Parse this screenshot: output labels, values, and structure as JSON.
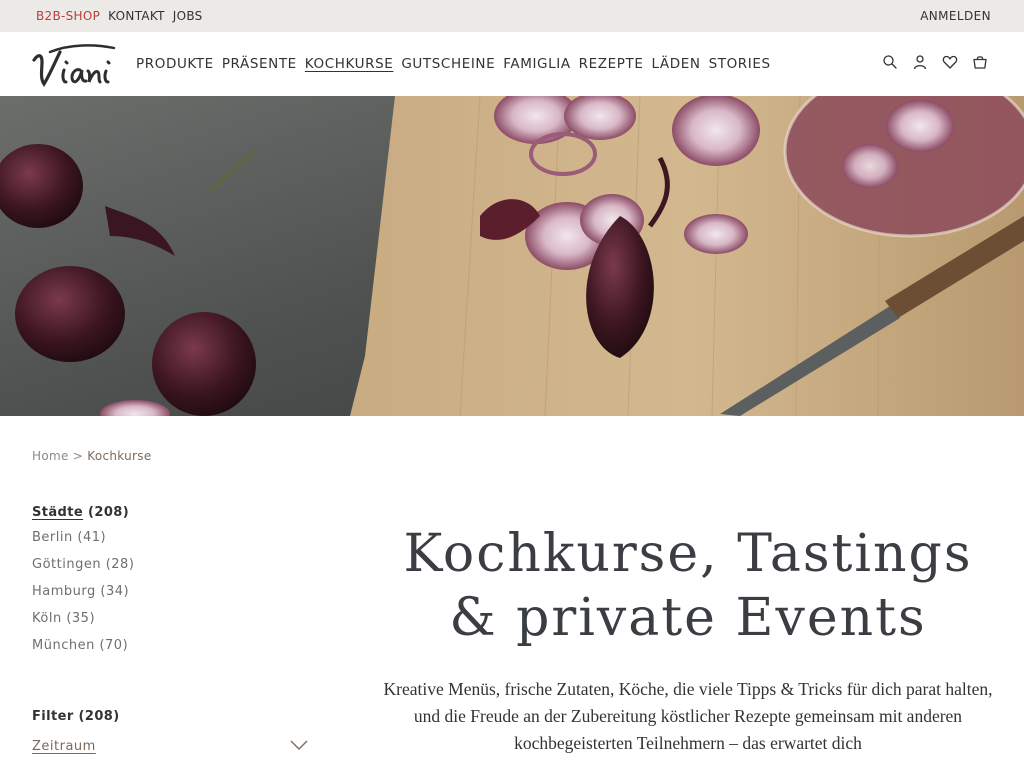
{
  "topbar": {
    "b2b": "B2B-SHOP",
    "contact": "KONTAKT",
    "jobs": "JOBS",
    "login": "ANMELDEN"
  },
  "header": {
    "logo_text": "Viani",
    "nav": [
      "PRODUKTE",
      "PRÄSENTE",
      "KOCHKURSE",
      "GUTSCHEINE",
      "FAMIGLIA",
      "REZEPTE",
      "LÄDEN",
      "STORIES"
    ],
    "active_nav": "KOCHKURSE",
    "icons": [
      "search-icon",
      "user-icon",
      "heart-icon",
      "cart-icon"
    ]
  },
  "breadcrumb": {
    "home": "Home",
    "sep": ">",
    "current": "Kochkurse"
  },
  "sidebar": {
    "cities_label": "Städte",
    "cities_count": "(208)",
    "cities": [
      {
        "name": "Berlin",
        "count": "(41)"
      },
      {
        "name": "Göttingen",
        "count": "(28)"
      },
      {
        "name": "Hamburg",
        "count": "(34)"
      },
      {
        "name": "Köln",
        "count": "(35)"
      },
      {
        "name": "München",
        "count": "(70)"
      }
    ],
    "filter_label": "Filter (208)",
    "zeitraum": "Zeitraum"
  },
  "main": {
    "title_line1": "Kochkurse, Tastings",
    "title_line2": "& private Events",
    "lead": "Kreative Menüs, frische Zutaten, Köche, die viele Tipps & Tricks für dich parat halten, und die Freude an der Zubereitung köstlicher Rezepte gemeinsam mit anderen kochbegeisterten Teilnehmern – das erwartet dich"
  },
  "colors": {
    "topbar_bg": "#ebeae7",
    "b2b_red": "#b5403a",
    "accent_brown": "#7b6a5c",
    "heading": "#3a3d42"
  }
}
